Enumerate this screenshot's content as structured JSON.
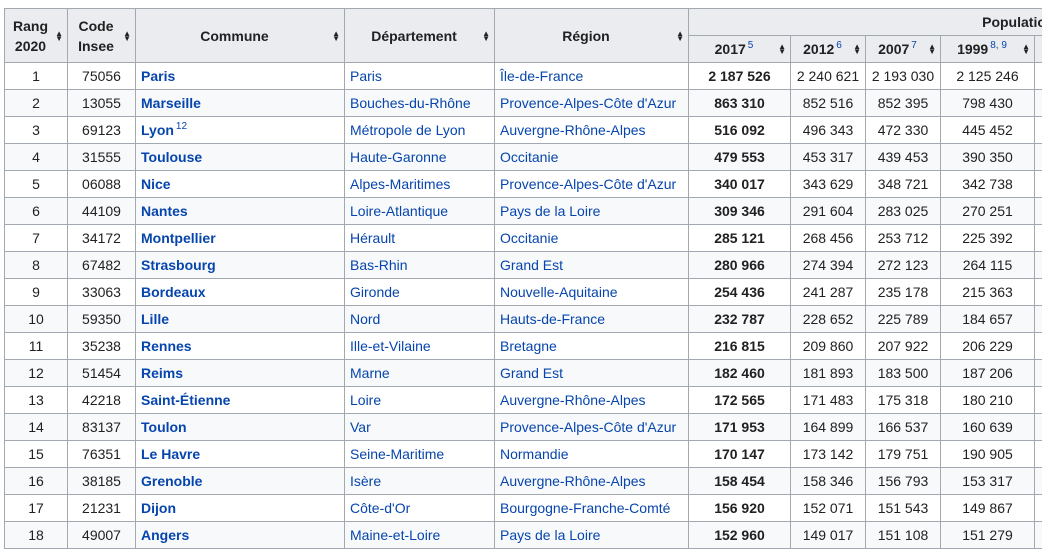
{
  "headers": {
    "rang": [
      "Rang",
      "2020"
    ],
    "code": [
      "Code",
      "Insee"
    ],
    "commune": "Commune",
    "departement": "Département",
    "region": "Région",
    "population_group": "Population lé",
    "years": [
      {
        "label": "2017",
        "ref": "5"
      },
      {
        "label": "2012",
        "ref": "6"
      },
      {
        "label": "2007",
        "ref": "7"
      },
      {
        "label": "1999",
        "ref": "8, 9"
      }
    ]
  },
  "rows": [
    {
      "rang": "1",
      "code": "75056",
      "commune": "Paris",
      "ref": "",
      "departement": "Paris",
      "region": "Île-de-France",
      "p2017": "2 187 526",
      "p2012": "2 240 621",
      "p2007": "2 193 030",
      "p1999": "2 125 246"
    },
    {
      "rang": "2",
      "code": "13055",
      "commune": "Marseille",
      "ref": "",
      "departement": "Bouches-du-Rhône",
      "region": "Provence-Alpes-Côte d'Azur",
      "p2017": "863 310",
      "p2012": "852 516",
      "p2007": "852 395",
      "p1999": "798 430"
    },
    {
      "rang": "3",
      "code": "69123",
      "commune": "Lyon",
      "ref": "12",
      "departement": "Métropole de Lyon",
      "region": "Auvergne-Rhône-Alpes",
      "p2017": "516 092",
      "p2012": "496 343",
      "p2007": "472 330",
      "p1999": "445 452"
    },
    {
      "rang": "4",
      "code": "31555",
      "commune": "Toulouse",
      "ref": "",
      "departement": "Haute-Garonne",
      "region": "Occitanie",
      "p2017": "479 553",
      "p2012": "453 317",
      "p2007": "439 453",
      "p1999": "390 350"
    },
    {
      "rang": "5",
      "code": "06088",
      "commune": "Nice",
      "ref": "",
      "departement": "Alpes-Maritimes",
      "region": "Provence-Alpes-Côte d'Azur",
      "p2017": "340 017",
      "p2012": "343 629",
      "p2007": "348 721",
      "p1999": "342 738"
    },
    {
      "rang": "6",
      "code": "44109",
      "commune": "Nantes",
      "ref": "",
      "departement": "Loire-Atlantique",
      "region": "Pays de la Loire",
      "p2017": "309 346",
      "p2012": "291 604",
      "p2007": "283 025",
      "p1999": "270 251"
    },
    {
      "rang": "7",
      "code": "34172",
      "commune": "Montpellier",
      "ref": "",
      "departement": "Hérault",
      "region": "Occitanie",
      "p2017": "285 121",
      "p2012": "268 456",
      "p2007": "253 712",
      "p1999": "225 392"
    },
    {
      "rang": "8",
      "code": "67482",
      "commune": "Strasbourg",
      "ref": "",
      "departement": "Bas-Rhin",
      "region": "Grand Est",
      "p2017": "280 966",
      "p2012": "274 394",
      "p2007": "272 123",
      "p1999": "264 115"
    },
    {
      "rang": "9",
      "code": "33063",
      "commune": "Bordeaux",
      "ref": "",
      "departement": "Gironde",
      "region": "Nouvelle-Aquitaine",
      "p2017": "254 436",
      "p2012": "241 287",
      "p2007": "235 178",
      "p1999": "215 363"
    },
    {
      "rang": "10",
      "code": "59350",
      "commune": "Lille",
      "ref": "",
      "departement": "Nord",
      "region": "Hauts-de-France",
      "p2017": "232 787",
      "p2012": "228 652",
      "p2007": "225 789",
      "p1999": "184 657"
    },
    {
      "rang": "11",
      "code": "35238",
      "commune": "Rennes",
      "ref": "",
      "departement": "Ille-et-Vilaine",
      "region": "Bretagne",
      "p2017": "216 815",
      "p2012": "209 860",
      "p2007": "207 922",
      "p1999": "206 229"
    },
    {
      "rang": "12",
      "code": "51454",
      "commune": "Reims",
      "ref": "",
      "departement": "Marne",
      "region": "Grand Est",
      "p2017": "182 460",
      "p2012": "181 893",
      "p2007": "183 500",
      "p1999": "187 206"
    },
    {
      "rang": "13",
      "code": "42218",
      "commune": "Saint-Étienne",
      "ref": "",
      "departement": "Loire",
      "region": "Auvergne-Rhône-Alpes",
      "p2017": "172 565",
      "p2012": "171 483",
      "p2007": "175 318",
      "p1999": "180 210"
    },
    {
      "rang": "14",
      "code": "83137",
      "commune": "Toulon",
      "ref": "",
      "departement": "Var",
      "region": "Provence-Alpes-Côte d'Azur",
      "p2017": "171 953",
      "p2012": "164 899",
      "p2007": "166 537",
      "p1999": "160 639"
    },
    {
      "rang": "15",
      "code": "76351",
      "commune": "Le Havre",
      "ref": "",
      "departement": "Seine-Maritime",
      "region": "Normandie",
      "p2017": "170 147",
      "p2012": "173 142",
      "p2007": "179 751",
      "p1999": "190 905"
    },
    {
      "rang": "16",
      "code": "38185",
      "commune": "Grenoble",
      "ref": "",
      "departement": "Isère",
      "region": "Auvergne-Rhône-Alpes",
      "p2017": "158 454",
      "p2012": "158 346",
      "p2007": "156 793",
      "p1999": "153 317"
    },
    {
      "rang": "17",
      "code": "21231",
      "commune": "Dijon",
      "ref": "",
      "departement": "Côte-d'Or",
      "region": "Bourgogne-Franche-Comté",
      "p2017": "156 920",
      "p2012": "152 071",
      "p2007": "151 543",
      "p1999": "149 867"
    },
    {
      "rang": "18",
      "code": "49007",
      "commune": "Angers",
      "ref": "",
      "departement": "Maine-et-Loire",
      "region": "Pays de la Loire",
      "p2017": "152 960",
      "p2012": "149 017",
      "p2007": "151 108",
      "p1999": "151 279"
    }
  ],
  "colors": {
    "link": "#0645ad",
    "header_bg": "#eaecf0",
    "border": "#a2a9b1",
    "row_alt": "#f8f9fa"
  }
}
